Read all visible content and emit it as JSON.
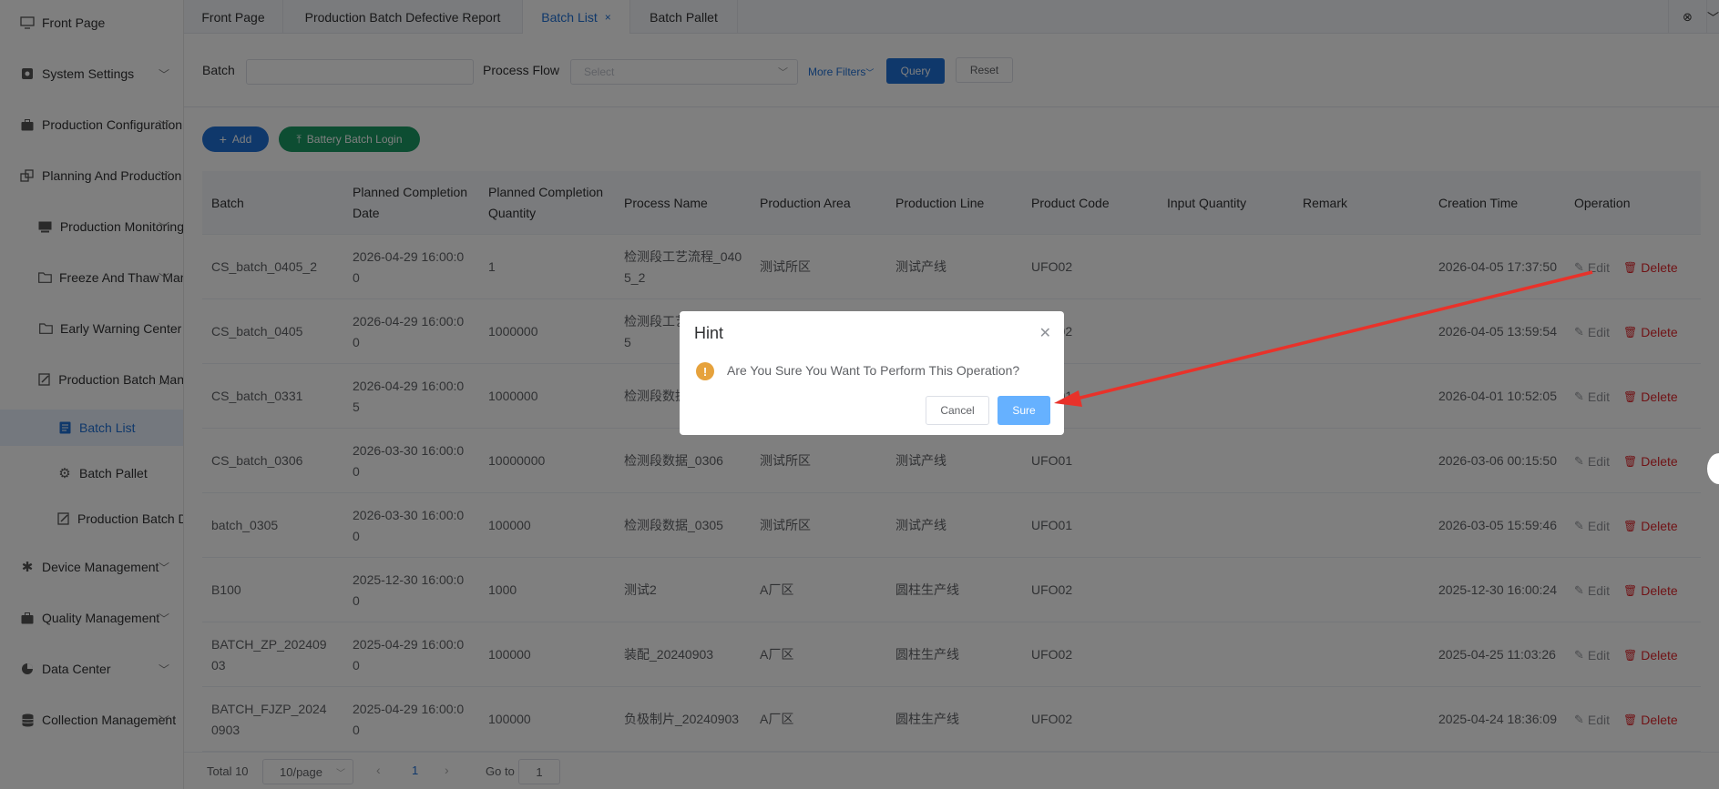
{
  "sidebar": {
    "items": [
      {
        "label": "Front Page",
        "icon": "monitor-icon"
      },
      {
        "label": "System Settings",
        "icon": "settings-icon"
      },
      {
        "label": "Production Configuration",
        "icon": "briefcase-icon"
      },
      {
        "label": "Planning And Production",
        "icon": "planning-icon"
      },
      {
        "label": "Production Monitoring",
        "icon": "monitoring-icon"
      },
      {
        "label": "Freeze And Thaw Man",
        "icon": "folder-icon"
      },
      {
        "label": "Early Warning Center",
        "icon": "folder-icon"
      },
      {
        "label": "Production Batch Man",
        "icon": "edit-doc-icon"
      },
      {
        "label": "Batch List",
        "icon": "list-doc-icon"
      },
      {
        "label": "Batch Pallet",
        "icon": "gear-icon"
      },
      {
        "label": "Production Batch D",
        "icon": "edit-doc-icon"
      },
      {
        "label": "Device Management",
        "icon": "device-icon"
      },
      {
        "label": "Quality Management",
        "icon": "briefcase-icon"
      },
      {
        "label": "Data Center",
        "icon": "pie-chart-icon"
      },
      {
        "label": "Collection Management",
        "icon": "database-icon"
      }
    ]
  },
  "tabs": [
    {
      "label": "Front Page"
    },
    {
      "label": "Production Batch Defective Report"
    },
    {
      "label": "Batch List",
      "close": "×"
    },
    {
      "label": "Batch Pallet"
    }
  ],
  "filter": {
    "batch_label": "Batch",
    "batch_value": "",
    "process_flow_label": "Process Flow",
    "process_flow_placeholder": "Select",
    "more_filters": "More Filters",
    "query": "Query",
    "reset": "Reset"
  },
  "actions": {
    "add": "Add",
    "battery_batch_login": "Battery Batch Login"
  },
  "table": {
    "columns": [
      "Batch",
      "Planned Completion Date",
      "Planned Completion Quantity",
      "Process Name",
      "Production Area",
      "Production Line",
      "Product Code",
      "Input Quantity",
      "Remark",
      "Creation Time",
      "Operation"
    ],
    "edit_label": "Edit",
    "delete_label": "Delete",
    "rows": [
      {
        "batch": "CS_batch_0405_2",
        "date": "2026-04-29 16:00:00",
        "qty": "1",
        "process": "检测段工艺流程_0405_2",
        "area": "测试所区",
        "line": "测试产线",
        "code": "UFO02",
        "input": "",
        "remark": "",
        "created": "2026-04-05 17:37:50"
      },
      {
        "batch": "CS_batch_0405",
        "date": "2026-04-29 16:00:00",
        "qty": "1000000",
        "process": "检测段工艺流程_0405",
        "area": "",
        "line": "",
        "code": "UFO02",
        "input": "",
        "remark": "",
        "created": "2026-04-05 13:59:54"
      },
      {
        "batch": "CS_batch_0331",
        "date": "2026-04-29 16:00:05",
        "qty": "1000000",
        "process": "检测段数据",
        "area": "",
        "line": "",
        "code": "UFO01",
        "input": "",
        "remark": "",
        "created": "2026-04-01 10:52:05"
      },
      {
        "batch": "CS_batch_0306",
        "date": "2026-03-30 16:00:00",
        "qty": "10000000",
        "process": "检测段数据_0306",
        "area": "测试所区",
        "line": "测试产线",
        "code": "UFO01",
        "input": "",
        "remark": "",
        "created": "2026-03-06 00:15:50"
      },
      {
        "batch": "batch_0305",
        "date": "2026-03-30 16:00:00",
        "qty": "100000",
        "process": "检测段数据_0305",
        "area": "测试所区",
        "line": "测试产线",
        "code": "UFO01",
        "input": "",
        "remark": "",
        "created": "2026-03-05 15:59:46"
      },
      {
        "batch": "B100",
        "date": "2025-12-30 16:00:00",
        "qty": "1000",
        "process": "测试2",
        "area": "A厂区",
        "line": "圆柱生产线",
        "code": "UFO02",
        "input": "",
        "remark": "",
        "created": "2025-12-30 16:00:24"
      },
      {
        "batch": "BATCH_ZP_20240903",
        "date": "2025-04-29 16:00:00",
        "qty": "100000",
        "process": "装配_20240903",
        "area": "A厂区",
        "line": "圆柱生产线",
        "code": "UFO02",
        "input": "",
        "remark": "",
        "created": "2025-04-25 11:03:26"
      },
      {
        "batch": "BATCH_FJZP_20240903",
        "date": "2025-04-29 16:00:00",
        "qty": "100000",
        "process": "负极制片_20240903",
        "area": "A厂区",
        "line": "圆柱生产线",
        "code": "UFO02",
        "input": "",
        "remark": "",
        "created": "2025-04-24 18:36:09"
      }
    ]
  },
  "pagination": {
    "total": "Total 10",
    "page_size": "10/page",
    "current": "1",
    "goto_label": "Go to",
    "goto_value": "1"
  },
  "dialog": {
    "title": "Hint",
    "message": "Are You Sure You Want To Perform This Operation?",
    "cancel": "Cancel",
    "sure": "Sure"
  },
  "colors": {
    "accent": "#1f70d6",
    "success": "#1b9a64",
    "danger": "#e0262c",
    "warning": "#e6a23c",
    "annotation_arrow": "#e8322a"
  }
}
